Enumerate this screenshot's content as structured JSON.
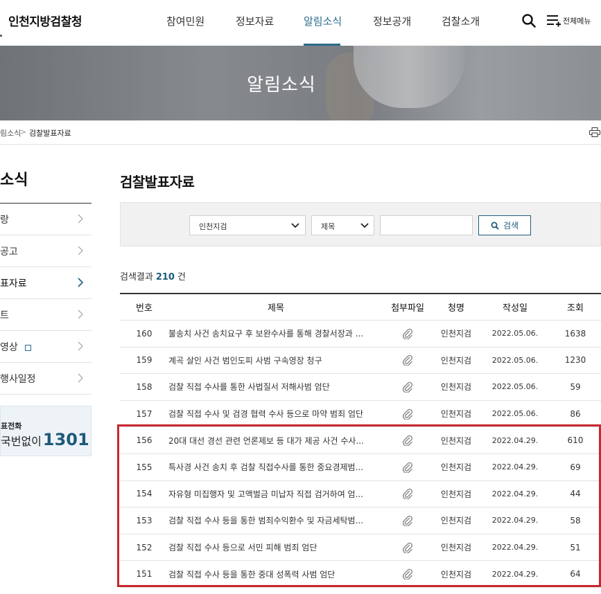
{
  "site": {
    "logo": "인천지방검찰청"
  },
  "gnb": {
    "items": [
      {
        "label": "참여민원"
      },
      {
        "label": "정보자료"
      },
      {
        "label": "알림소식"
      },
      {
        "label": "정보공개"
      },
      {
        "label": "검찰소개"
      }
    ],
    "active_index": 2,
    "menu_label": "전체메뉴"
  },
  "hero": {
    "title": "알림소식"
  },
  "breadcrumb": {
    "parent": "림소식",
    "separator": ">",
    "current": "검찰발표자료"
  },
  "lnb": {
    "title": "소식",
    "items": [
      {
        "label": "랑"
      },
      {
        "label": "공고"
      },
      {
        "label": "표자료"
      },
      {
        "label": "트"
      },
      {
        "label": "영상"
      },
      {
        "label": "행사일정"
      }
    ],
    "active_index": 2,
    "phone_label": "표전화",
    "phone_prefix": "국번없이",
    "phone_number": "1301"
  },
  "main": {
    "title": "검찰발표자료",
    "search": {
      "scope_value": "인천지검",
      "field_value": "제목",
      "query_value": "",
      "button_label": "검색"
    },
    "result": {
      "prefix": "검색결과",
      "count": "210",
      "suffix": "건"
    },
    "table": {
      "headers": {
        "no": "번호",
        "title": "제목",
        "file": "첨부파일",
        "dept": "청명",
        "date": "작성일",
        "views": "조회"
      },
      "rows": [
        {
          "no": "160",
          "title": "불송치 사건 송치요구 후 보완수사를 통해 경찰서장과 ...",
          "dept": "인천지검",
          "date": "2022.05.06.",
          "views": "1638"
        },
        {
          "no": "159",
          "title": "계곡 살인 사건 범인도피 사범 구속영장 청구",
          "dept": "인천지검",
          "date": "2022.05.06.",
          "views": "1230"
        },
        {
          "no": "158",
          "title": "검찰 직접 수사를 통한 사법질서 저해사범 엄단",
          "dept": "인천지검",
          "date": "2022.05.06.",
          "views": "59"
        },
        {
          "no": "157",
          "title": "검찰 직접 수사 및 검경 협력 수사 등으로 마약 범죄 엄단",
          "dept": "인천지검",
          "date": "2022.05.06.",
          "views": "86"
        },
        {
          "no": "156",
          "title": "20대 대선 경선 관련 언론제보 등 대가 제공 사건 수사...",
          "dept": "인천지검",
          "date": "2022.04.29.",
          "views": "610"
        },
        {
          "no": "155",
          "title": "특사경 사건 송치 후 검찰 직접수사를 통한 중요경제범...",
          "dept": "인천지검",
          "date": "2022.04.29.",
          "views": "69"
        },
        {
          "no": "154",
          "title": "자유형 미집행자 및 고액벌금 미납자 직접 검거하여 엄...",
          "dept": "인천지검",
          "date": "2022.04.29.",
          "views": "44"
        },
        {
          "no": "153",
          "title": "검찰 직접 수사 등을 통한 범죄수익환수 및 자금세탁범...",
          "dept": "인천지검",
          "date": "2022.04.29.",
          "views": "58"
        },
        {
          "no": "152",
          "title": "검찰 직접 수사 등으로 서민 피해 범죄 엄단",
          "dept": "인천지검",
          "date": "2022.04.29.",
          "views": "51"
        },
        {
          "no": "151",
          "title": "검찰 직접 수사 등을 통한 중대 성폭력 사범 엄단",
          "dept": "인천지검",
          "date": "2022.04.29.",
          "views": "64"
        }
      ]
    }
  },
  "colors": {
    "accent": "#1e5a7a",
    "nav_active": "#2a6d8c",
    "highlight": "#c8272d"
  },
  "icons": {
    "search": "search-icon",
    "menu": "menu-plus-icon",
    "print": "printer-icon",
    "attachment": "paperclip-icon",
    "chevron": "chevron-right-icon",
    "external": "external-link-icon"
  }
}
